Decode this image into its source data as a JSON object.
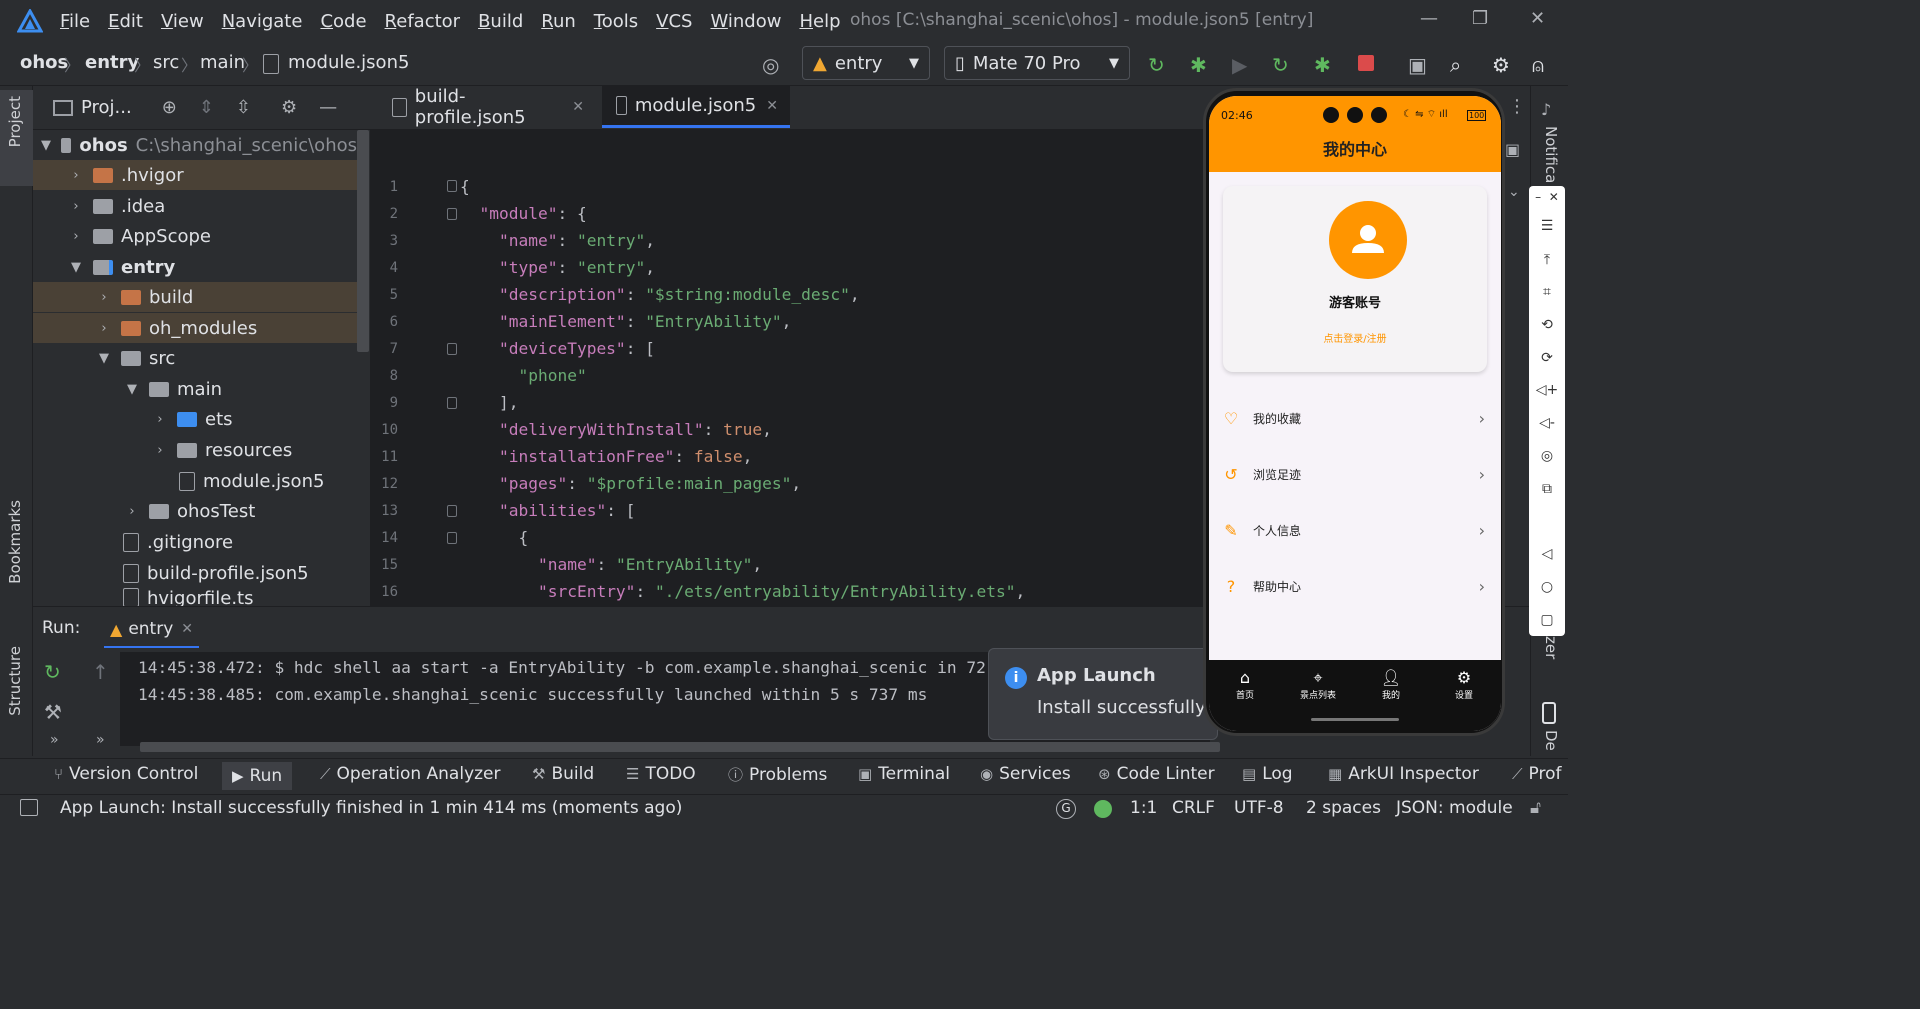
{
  "menubar": {
    "items": [
      "File",
      "Edit",
      "View",
      "Navigate",
      "Code",
      "Refactor",
      "Build",
      "Run",
      "Tools",
      "VCS",
      "Window",
      "Help"
    ],
    "window_title": "ohos [C:\\shanghai_scenic\\ohos] - module.json5 [entry]"
  },
  "breadcrumb": {
    "items": [
      "ohos",
      "entry",
      "src",
      "main",
      "module.json5"
    ]
  },
  "toolbar": {
    "run_config": "entry",
    "device": "Mate 70 Pro"
  },
  "project_panel": {
    "title": "Proj...",
    "tree": [
      {
        "label": "ohos",
        "path": "C:\\shanghai_scenic\\ohos",
        "expanded": true
      },
      {
        "label": ".hvigor",
        "expanded": false
      },
      {
        "label": ".idea",
        "expanded": false
      },
      {
        "label": "AppScope",
        "expanded": false
      },
      {
        "label": "entry",
        "expanded": true
      },
      {
        "label": "build",
        "expanded": false
      },
      {
        "label": "oh_modules",
        "expanded": false
      },
      {
        "label": "src",
        "expanded": true
      },
      {
        "label": "main",
        "expanded": true
      },
      {
        "label": "ets",
        "expanded": false
      },
      {
        "label": "resources",
        "expanded": false
      },
      {
        "label": "module.json5"
      },
      {
        "label": "ohosTest",
        "expanded": false
      },
      {
        "label": ".gitignore"
      },
      {
        "label": "build-profile.json5"
      },
      {
        "label": "hvigorfile.ts"
      }
    ]
  },
  "editor": {
    "tabs": [
      {
        "label": "build-profile.json5",
        "active": false
      },
      {
        "label": "module.json5",
        "active": true
      }
    ],
    "line_numbers": [
      "1",
      "2",
      "3",
      "4",
      "5",
      "6",
      "7",
      "8",
      "9",
      "10",
      "11",
      "12",
      "13",
      "14",
      "15",
      "16"
    ]
  },
  "run_panel": {
    "title": "Run:",
    "tab": "entry",
    "console": [
      "14:45:38.472: $ hdc shell aa start -a EntryAbility -b com.example.shanghai_scenic in 72",
      "14:45:38.485: com.example.shanghai_scenic successfully launched within 5 s 737 ms"
    ]
  },
  "notification": {
    "title": "App Launch",
    "body": "Install successfully fi"
  },
  "tool_windows": [
    {
      "label": "Version Control",
      "icon": "branch-icon"
    },
    {
      "label": "Run",
      "icon": "play-icon"
    },
    {
      "label": "Operation Analyzer",
      "icon": "chart-icon"
    },
    {
      "label": "Build",
      "icon": "hammer-icon"
    },
    {
      "label": "TODO",
      "icon": "list-icon"
    },
    {
      "label": "Problems",
      "icon": "alert-icon"
    },
    {
      "label": "Terminal",
      "icon": "terminal-icon"
    },
    {
      "label": "Services",
      "icon": "services-icon"
    },
    {
      "label": "Code Linter",
      "icon": "linter-icon"
    },
    {
      "label": "Log",
      "icon": "log-icon"
    },
    {
      "label": "ArkUI Inspector",
      "icon": "inspector-icon"
    },
    {
      "label": "Prof",
      "icon": "profiler-icon"
    }
  ],
  "statusbar": {
    "message": "App Launch: Install successfully finished in 1 min 414 ms (moments ago)",
    "position": "1:1",
    "line_ending": "CRLF",
    "encoding": "UTF-8",
    "indent": "2 spaces",
    "file_type": "JSON: module"
  },
  "side_tabs": {
    "project": "Project",
    "bookmarks": "Bookmarks",
    "structure": "Structure",
    "notifications": "Notifica",
    "analyzer": "zer",
    "device": "De"
  },
  "phone": {
    "time": "02:46",
    "battery": "100",
    "header_title": "我的中心",
    "account_name": "游客账号",
    "login_link": "点击登录/注册",
    "menu": [
      {
        "label": "我的收藏",
        "icon": "heart-icon"
      },
      {
        "label": "浏览足迹",
        "icon": "history-icon"
      },
      {
        "label": "个人信息",
        "icon": "edit-icon"
      },
      {
        "label": "帮助中心",
        "icon": "help-icon"
      }
    ],
    "tabs": [
      {
        "label": "首页",
        "icon": "home-icon"
      },
      {
        "label": "景点列表",
        "icon": "location-icon"
      },
      {
        "label": "我的",
        "icon": "user-icon"
      },
      {
        "label": "设置",
        "icon": "settings-icon"
      }
    ],
    "accent": "#ff9500"
  },
  "colors": {
    "ide_bg": "#2b2d30",
    "editor_bg": "#1e1f22",
    "accent_blue": "#3574f0",
    "string_green": "#6aab73",
    "key_purple": "#c77dbb",
    "keyword_orange": "#cf8e6d"
  }
}
